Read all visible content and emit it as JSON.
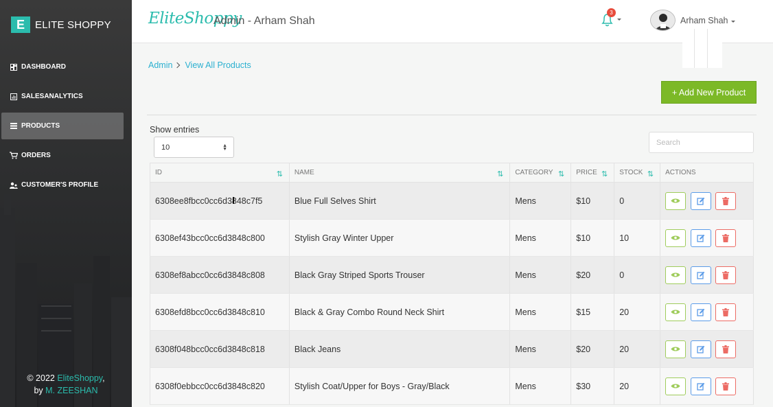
{
  "brand": {
    "logo_letter": "E",
    "name": "ELITE SHOPPY"
  },
  "nav": [
    {
      "label": "DASHBOARD",
      "icon": "dashboard-icon",
      "active": false
    },
    {
      "label": "SALESANALYTICS",
      "icon": "chart-icon",
      "active": false
    },
    {
      "label": "PRODUCTS",
      "icon": "list-icon",
      "active": true
    },
    {
      "label": "ORDERS",
      "icon": "cart-icon",
      "active": false
    },
    {
      "label": "CUSTOMER'S PROFILE",
      "icon": "users-icon",
      "active": false
    }
  ],
  "footer": {
    "prefix": "© 2022 ",
    "brand": "EliteShoppy",
    "comma": ",",
    "by": "by ",
    "author": "M. ZEESHAN"
  },
  "header": {
    "logo_text": "EliteShoppy",
    "title": "Admin - Arham Shah",
    "notification_count": "3",
    "user_name": "Arham Shah"
  },
  "breadcrumb": {
    "root": "Admin",
    "current": "View All Products"
  },
  "add_button": "+ Add New Product",
  "table_controls": {
    "show_entries_label": "Show entries",
    "entries_value": "10",
    "search_placeholder": "Search"
  },
  "colors": {
    "accent": "#2bbcad",
    "add_button": "#7cb927",
    "view": "#9fcc5b",
    "edit": "#5a9be8",
    "delete": "#ec6b64"
  },
  "table": {
    "columns": [
      "ID",
      "NAME",
      "CATEGORY",
      "PRICE",
      "STOCK",
      "ACTIONS"
    ],
    "rows": [
      {
        "id": "6308ee8fbcc0cc6d3848c7f5",
        "name": "Blue Full Selves Shirt",
        "category": "Mens",
        "price": "$10",
        "stock": "0"
      },
      {
        "id": "6308ef43bcc0cc6d3848c800",
        "name": "Stylish Gray Winter Upper",
        "category": "Mens",
        "price": "$10",
        "stock": "10"
      },
      {
        "id": "6308ef8abcc0cc6d3848c808",
        "name": "Black Gray Striped Sports Trouser",
        "category": "Mens",
        "price": "$20",
        "stock": "0"
      },
      {
        "id": "6308efd8bcc0cc6d3848c810",
        "name": "Black & Gray Combo Round Neck Shirt",
        "category": "Mens",
        "price": "$15",
        "stock": "20"
      },
      {
        "id": "6308f048bcc0cc6d3848c818",
        "name": "Black Jeans",
        "category": "Mens",
        "price": "$20",
        "stock": "20"
      },
      {
        "id": "6308f0ebbcc0cc6d3848c820",
        "name": "Stylish Coat/Upper for Boys - Gray/Black",
        "category": "Mens",
        "price": "$30",
        "stock": "20"
      }
    ]
  }
}
